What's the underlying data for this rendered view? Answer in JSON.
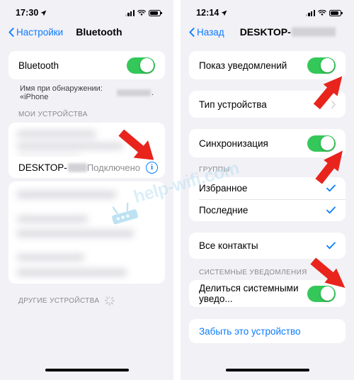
{
  "left_phone": {
    "status_bar": {
      "time": "17:30",
      "location_icon": "location-arrow-icon",
      "signal_icon": "cellular-signal-icon",
      "wifi_icon": "wifi-icon",
      "battery_icon": "battery-icon"
    },
    "nav": {
      "back_label": "Настройки",
      "title": "Bluetooth"
    },
    "bluetooth_row": {
      "label": "Bluetooth",
      "toggle_state": "on"
    },
    "discover_note_prefix": "Имя при обнаружении: «iPhone",
    "discover_note_suffix": ".",
    "my_devices_header": "МОИ УСТРОЙСТВА",
    "device": {
      "name_prefix": "DESKTOP-",
      "status": "Подключено",
      "info_icon": "info-circle-icon"
    },
    "other_devices_header": "ДРУГИЕ УСТРОЙСТВА"
  },
  "right_phone": {
    "status_bar": {
      "time": "12:14",
      "location_icon": "location-arrow-icon",
      "signal_icon": "cellular-signal-icon",
      "wifi_icon": "wifi-icon",
      "battery_icon": "battery-icon"
    },
    "nav": {
      "back_label": "Назад",
      "title": "DESKTOP-"
    },
    "rows": {
      "show_notifications": {
        "label": "Показ уведомлений",
        "toggle_state": "on"
      },
      "device_type": {
        "label": "Тип устройства",
        "accessory": "chevron-right-icon"
      },
      "sync": {
        "label": "Синхронизация",
        "toggle_state": "on"
      },
      "groups_header": "ГРУППЫ",
      "favorites": {
        "label": "Избранное",
        "checked": true
      },
      "recents": {
        "label": "Последние",
        "checked": true
      },
      "all_contacts": {
        "label": "Все контакты",
        "checked": true
      },
      "system_notifications_header": "СИСТЕМНЫЕ УВЕДОМЛЕНИЯ",
      "share_system": {
        "label": "Делиться системными уведо...",
        "toggle_state": "on"
      },
      "forget_device": {
        "label": "Забыть это устройство"
      }
    }
  },
  "watermark": {
    "text": "help-wifi.com",
    "icon": "router-icon"
  },
  "colors": {
    "accent_blue": "#0a7cff",
    "toggle_green": "#34c759",
    "arrow_red": "#e8241c",
    "page_bg": "#f2f1f6",
    "card_bg": "#ffffff",
    "secondary_text": "#8e8e93"
  },
  "annotations": {
    "arrow_1": "red-arrow-to-info-button",
    "arrow_2": "red-arrow-to-show-notifications-toggle",
    "arrow_3": "red-arrow-to-sync-toggle",
    "arrow_4": "red-arrow-to-share-system-toggle"
  }
}
